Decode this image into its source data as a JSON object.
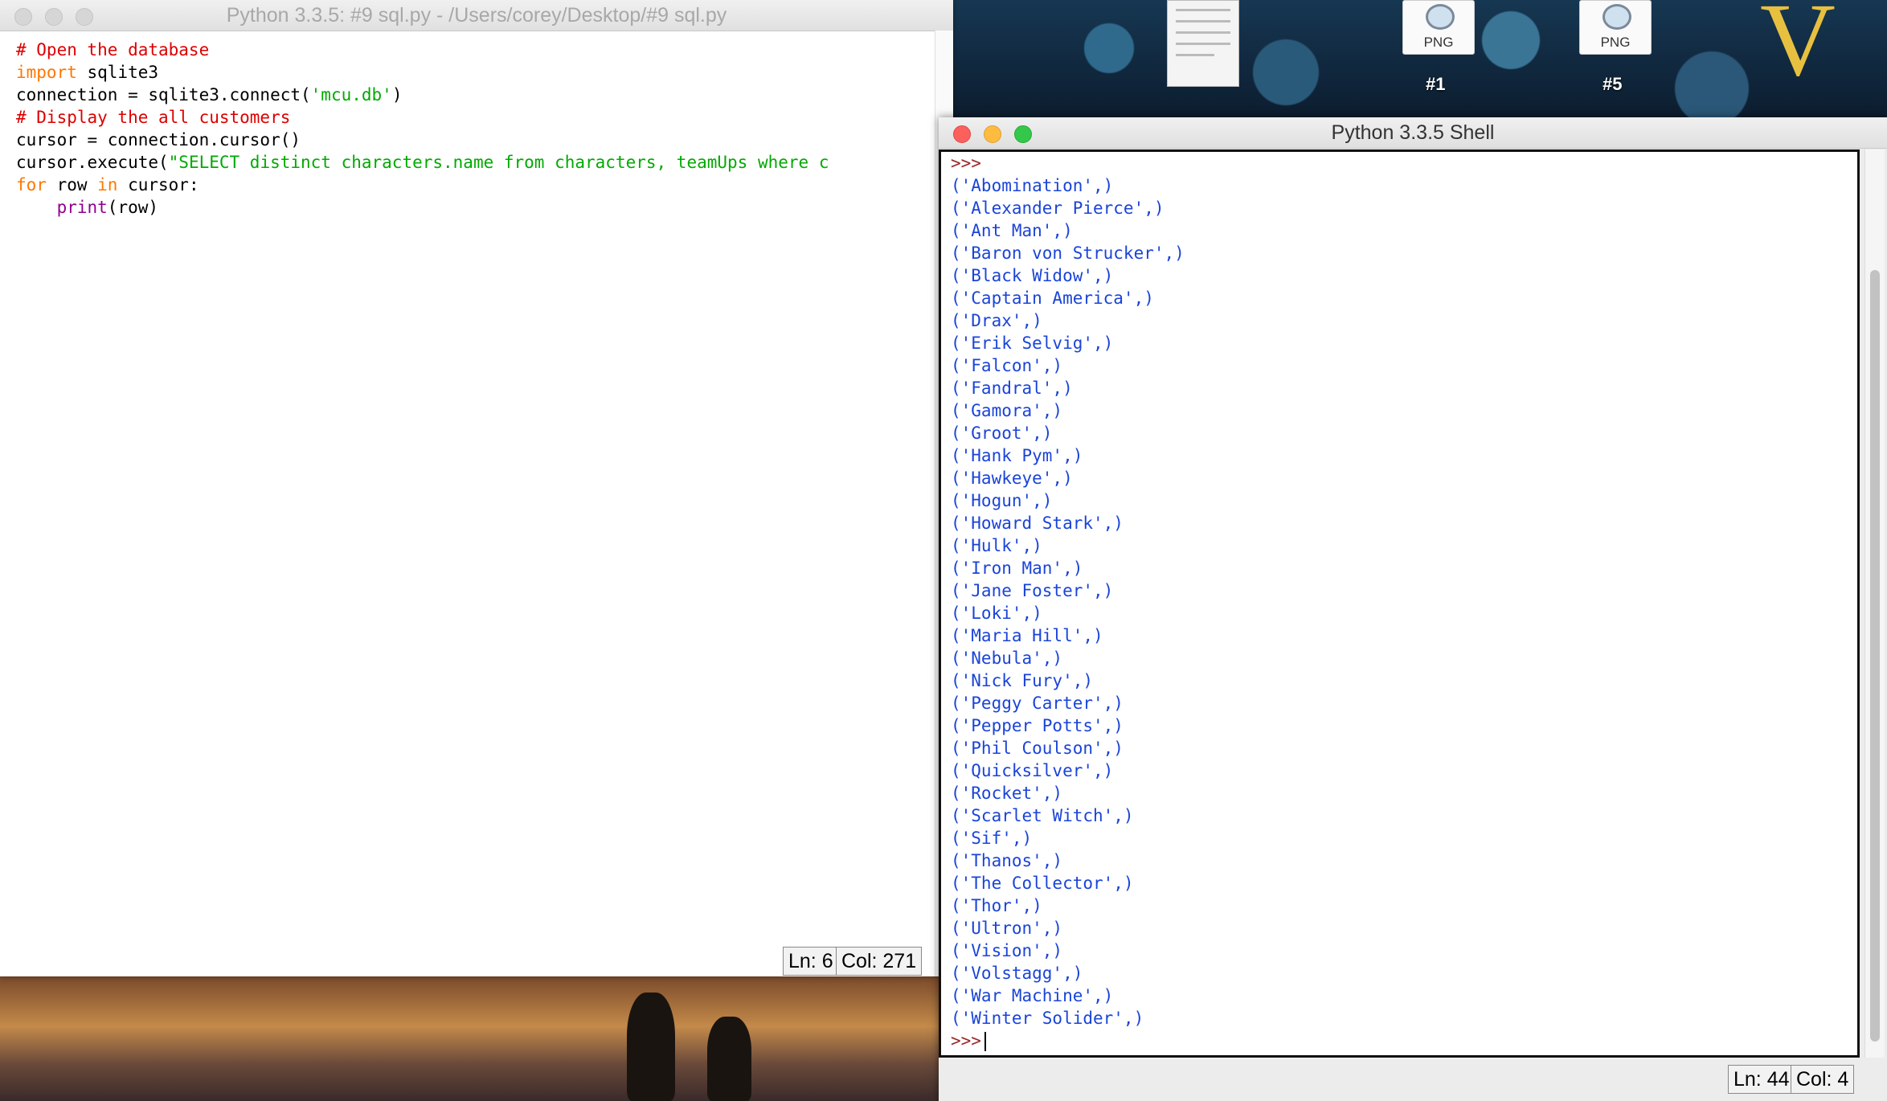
{
  "editor": {
    "title": "Python 3.3.5: #9 sql.py - /Users/corey/Desktop/#9 sql.py",
    "status_line": "Ln: 6",
    "status_col": "Col: 271"
  },
  "code_lines": [
    [
      {
        "t": "# Open the database",
        "c": "comment"
      }
    ],
    [
      {
        "t": "import",
        "c": "kw"
      },
      {
        "t": " sqlite3",
        "c": "plain"
      }
    ],
    [
      {
        "t": "connection = sqlite3.connect(",
        "c": "plain"
      },
      {
        "t": "'mcu.db'",
        "c": "str"
      },
      {
        "t": ")",
        "c": "plain"
      }
    ],
    [
      {
        "t": "# Display the all customers",
        "c": "comment"
      }
    ],
    [
      {
        "t": "cursor = connection.cursor()",
        "c": "plain"
      }
    ],
    [
      {
        "t": "cursor.execute(",
        "c": "plain"
      },
      {
        "t": "\"SELECT distinct characters.name from characters, teamUps where c",
        "c": "str"
      }
    ],
    [
      {
        "t": "for",
        "c": "kw"
      },
      {
        "t": " row ",
        "c": "plain"
      },
      {
        "t": "in",
        "c": "kw"
      },
      {
        "t": " cursor:",
        "c": "plain"
      }
    ],
    [
      {
        "t": "    ",
        "c": "plain"
      },
      {
        "t": "print",
        "c": "builtin"
      },
      {
        "t": "(row)",
        "c": "plain"
      }
    ]
  ],
  "shell": {
    "title": "Python 3.3.5 Shell",
    "prompt": ">>>",
    "status_line": "Ln: 44",
    "status_col": "Col: 4",
    "output": [
      "('Abomination',)",
      "('Alexander Pierce',)",
      "('Ant Man',)",
      "('Baron von Strucker',)",
      "('Black Widow',)",
      "('Captain America',)",
      "('Drax',)",
      "('Erik Selvig',)",
      "('Falcon',)",
      "('Fandral',)",
      "('Gamora',)",
      "('Groot',)",
      "('Hank Pym',)",
      "('Hawkeye',)",
      "('Hogun',)",
      "('Howard Stark',)",
      "('Hulk',)",
      "('Iron Man',)",
      "('Jane Foster',)",
      "('Loki',)",
      "('Maria Hill',)",
      "('Nebula',)",
      "('Nick Fury',)",
      "('Peggy Carter',)",
      "('Pepper Potts',)",
      "('Phil Coulson',)",
      "('Quicksilver',)",
      "('Rocket',)",
      "('Scarlet Witch',)",
      "('Sif',)",
      "('Thanos',)",
      "('The Collector',)",
      "('Thor',)",
      "('Ultron',)",
      "('Vision',)",
      "('Volstagg',)",
      "('War Machine',)",
      "('Winter Solider',)"
    ]
  },
  "desktop": {
    "icons": [
      {
        "type": "PNG",
        "name": "#1"
      },
      {
        "type": "PNG",
        "name": "#5"
      }
    ]
  },
  "colors": {
    "comment": "#dd0000",
    "keyword": "#ff7700",
    "string": "#00aa00",
    "builtin": "#900090",
    "shell_output": "#1a44d8",
    "shell_prompt": "#9a2a2a"
  }
}
